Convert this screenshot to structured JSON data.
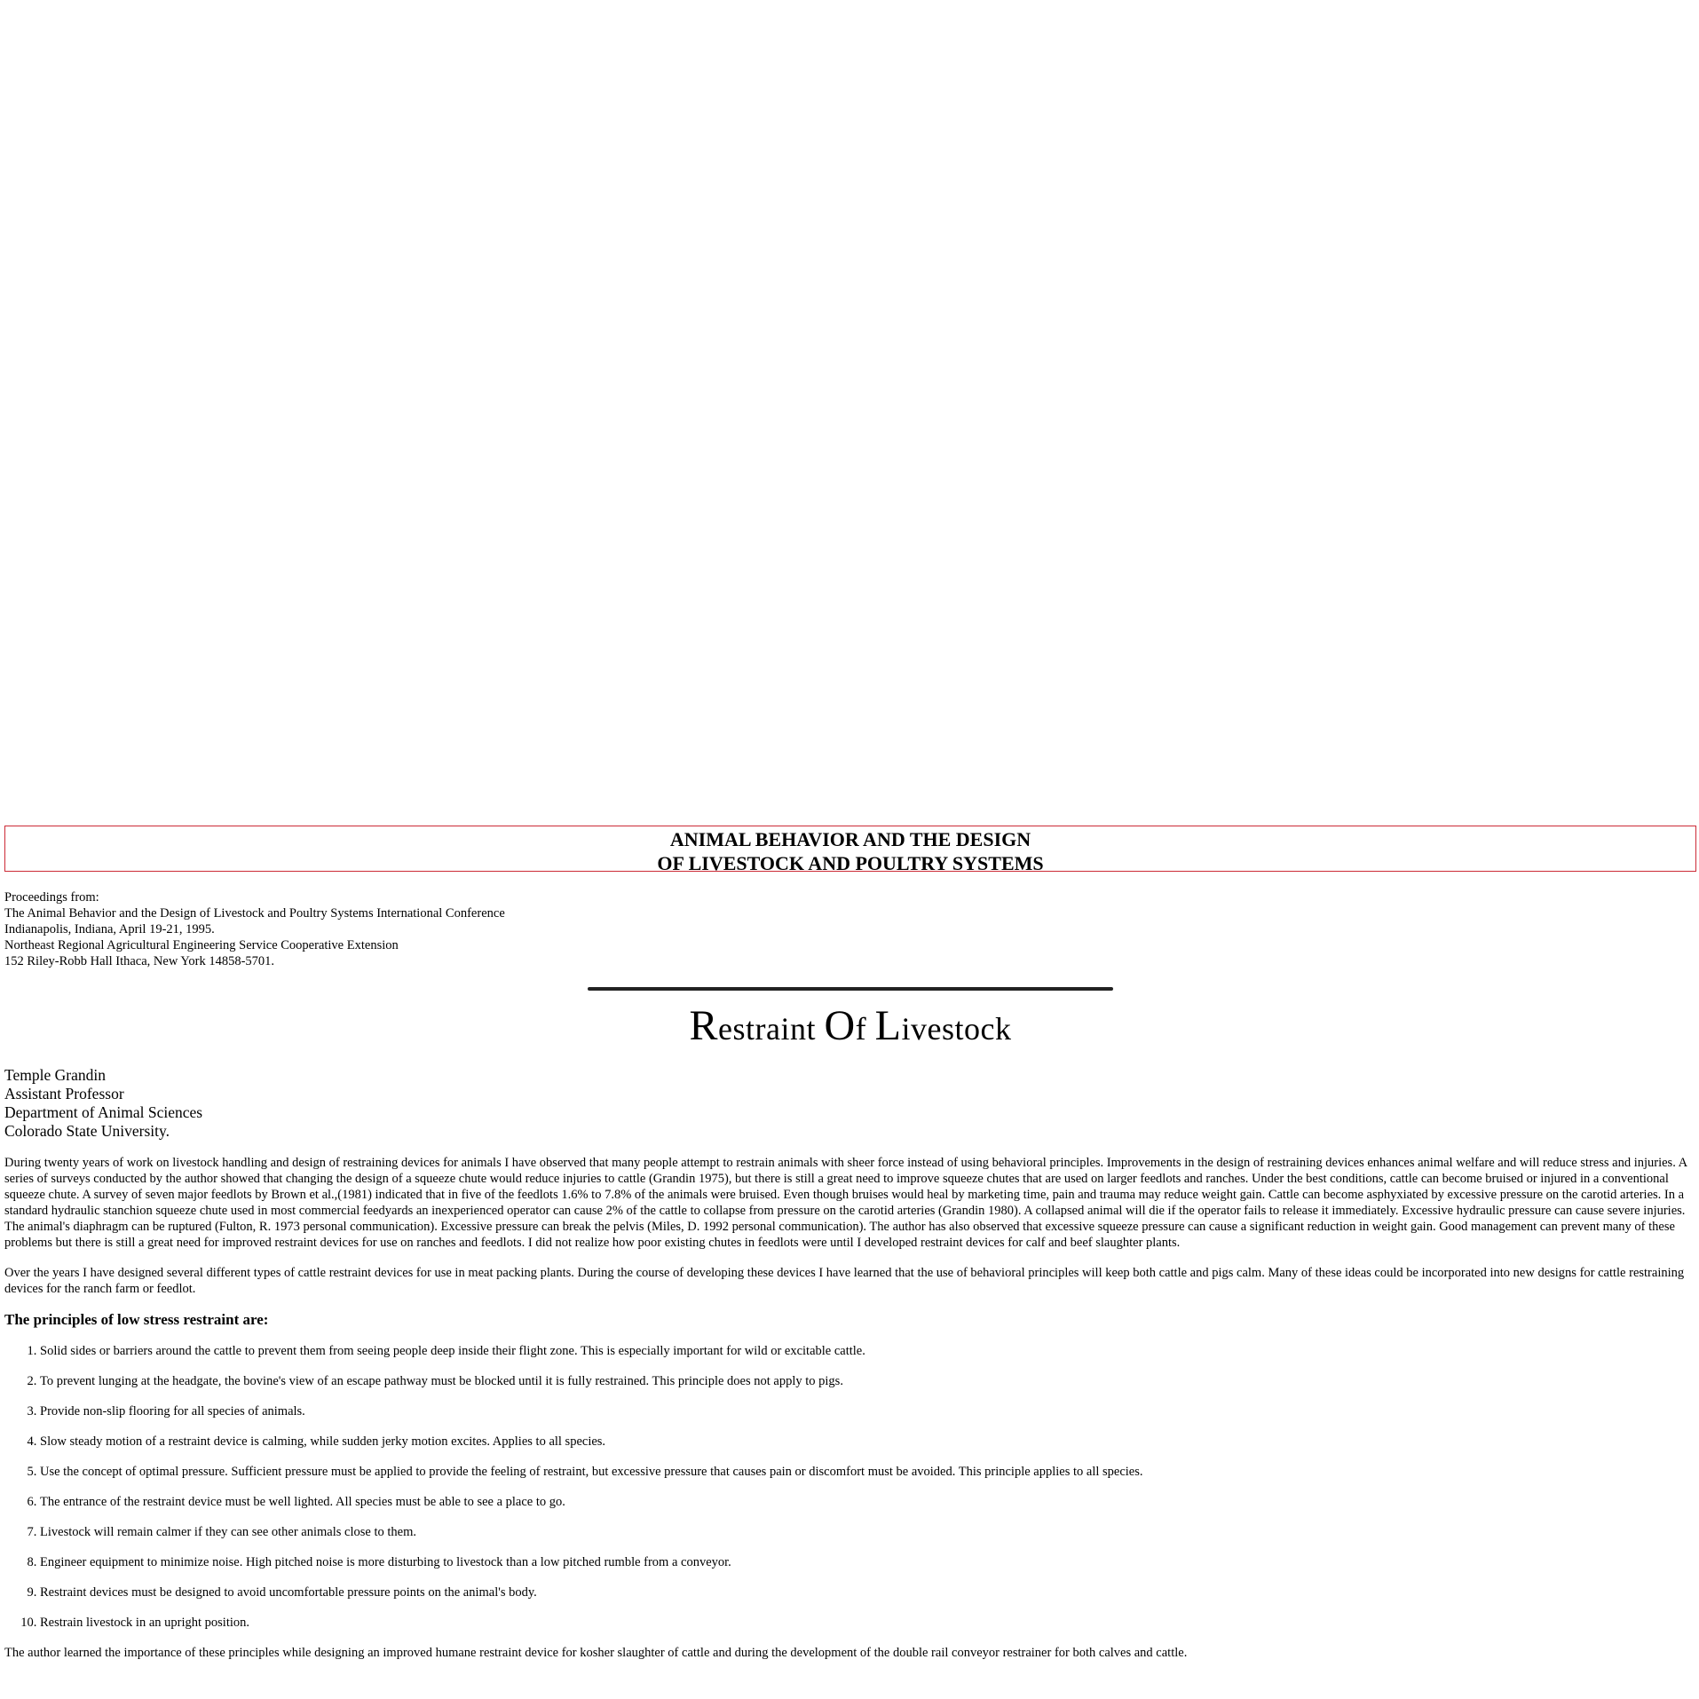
{
  "banner": {
    "line1": "ANIMAL BEHAVIOR AND THE DESIGN",
    "line2": "OF LIVESTOCK AND POULTRY SYSTEMS"
  },
  "proceedings": {
    "line1": "Proceedings from:",
    "line2": "The Animal Behavior and the Design of Livestock and Poultry Systems International Conference",
    "line3": "Indianapolis, Indiana, April 19-21, 1995.",
    "line4": "Northeast Regional Agricultural Engineering Service Cooperative Extension",
    "line5": "152 Riley-Robb Hall Ithaca, New York 14858-5701."
  },
  "title": {
    "w1_cap": "R",
    "w1_rest": "estraint",
    "w2_cap": "O",
    "w2_rest": "f",
    "w3_cap": "L",
    "w3_rest": "ivestock"
  },
  "author": {
    "name": "Temple Grandin",
    "position": "Assistant Professor",
    "department": "Department of Animal Sciences",
    "university": "Colorado State University."
  },
  "body": {
    "p1": "During twenty years of work on livestock handling and design of restraining devices for animals I have observed that many people attempt to restrain animals with sheer force instead of using behavioral principles. Improvements in the design of restraining devices enhances animal welfare and will reduce stress and injuries. A series of surveys conducted by the author showed that changing the design of a squeeze chute would reduce injuries to cattle (Grandin 1975), but there is still a great need to improve squeeze chutes that are used on larger feedlots and ranches. Under the best conditions, cattle can become bruised or injured in a conventional squeeze chute. A survey of seven major feedlots by Brown et al.,(1981) indicated that in five of the feedlots 1.6% to 7.8% of the animals were bruised. Even though bruises would heal by marketing time, pain and trauma may reduce weight gain. Cattle can become asphyxiated by excessive pressure on the carotid arteries. In a standard hydraulic stanchion squeeze chute used in most commercial feedyards an inexperienced operator can cause 2% of the cattle to collapse from pressure on the carotid arteries (Grandin 1980). A collapsed animal will die if the operator fails to release it immediately. Excessive hydraulic pressure can cause severe injuries. The animal's diaphragm can be ruptured (Fulton, R. 1973 personal communication). Excessive pressure can break the pelvis (Miles, D. 1992 personal communication). The author has also observed that excessive squeeze pressure can cause a significant reduction in weight gain. Good management can prevent many of these problems but there is still a great need for improved restraint devices for use on ranches and feedlots. I did not realize how poor existing chutes in feedlots were until I developed restraint devices for calf and beef slaughter plants.",
    "p2": "Over the years I have designed several different types of cattle restraint devices for use in meat packing plants. During the course of developing these devices I have learned that the use of behavioral principles will keep both cattle and pigs calm. Many of these ideas could be incorporated into new designs for cattle restraining devices for the ranch farm or feedlot.",
    "subhead": "The principles of low stress restraint are:",
    "principles": [
      "Solid sides or barriers around the cattle to prevent them from seeing people deep inside their flight zone. This is especially important for wild or excitable cattle.",
      "To prevent lunging at the headgate, the bovine's view of an escape pathway must be blocked until it is fully restrained. This principle does not apply to pigs.",
      "Provide non-slip flooring for all species of animals.",
      "Slow steady motion of a restraint device is calming, while sudden jerky motion excites. Applies to all species.",
      "Use the concept of optimal pressure. Sufficient pressure must be applied to provide the feeling of restraint, but excessive pressure that causes pain or discomfort must be avoided. This principle applies to all species.",
      "The entrance of the restraint device must be well lighted. All species must be able to see a place to go.",
      "Livestock will remain calmer if they can see other animals close to them.",
      "Engineer equipment to minimize noise. High pitched noise is more disturbing to livestock than a low pitched rumble from a conveyor.",
      "Restraint devices must be designed to avoid uncomfortable pressure points on the animal's body.",
      "Restrain livestock in an upright position."
    ],
    "p3": "The author learned the importance of these principles while designing an improved humane restraint device for kosher slaughter of cattle and during the development of the double rail conveyor restrainer for both calves and cattle."
  },
  "colors": {
    "banner_border": "#cc2a36",
    "rule": "#222222"
  }
}
